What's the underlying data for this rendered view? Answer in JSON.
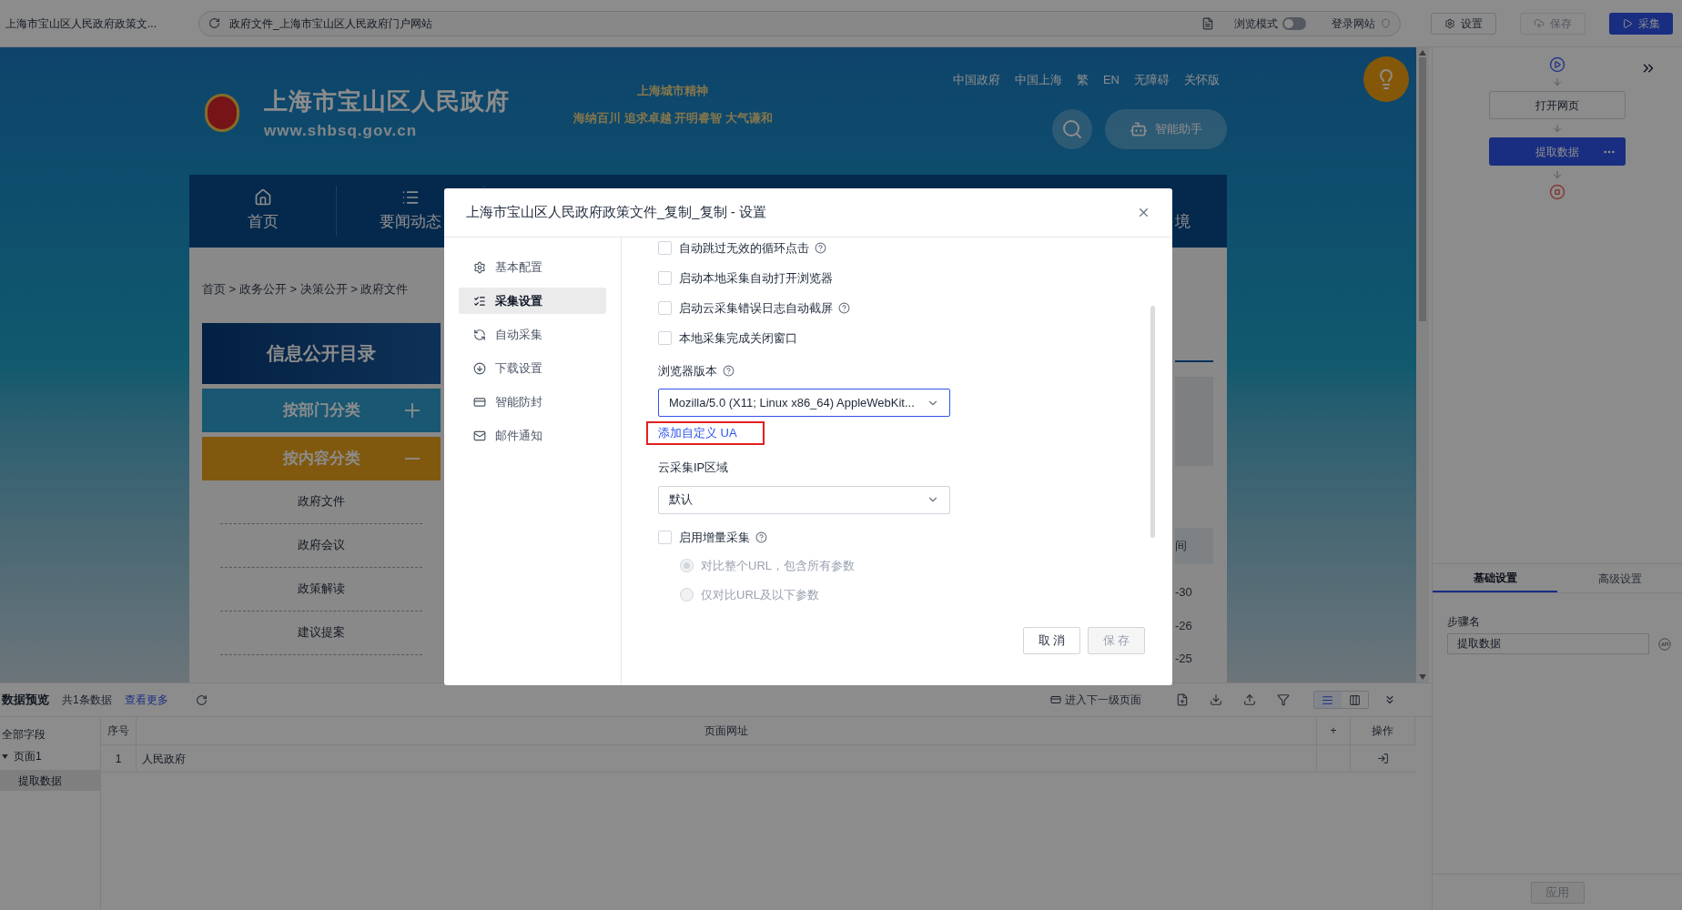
{
  "browser_bar": {
    "tab_title": "上海市宝山区人民政府政策文...",
    "address": "政府文件_上海市宝山区人民政府门户网站",
    "browse_mode": {
      "label": "浏览模式",
      "on": false
    },
    "login": "登录网站",
    "buttons": [
      {
        "label": "设置",
        "kind": "settings",
        "disabled": false
      },
      {
        "label": "保存",
        "kind": "save",
        "disabled": true
      },
      {
        "label": "采集",
        "kind": "run",
        "disabled": false
      }
    ]
  },
  "webpage": {
    "site_title": "上海市宝山区人民政府",
    "site_url": "www.shbsq.gov.cn",
    "slogan_title": "上海城市精神",
    "slogan": "海纳百川 追求卓越 开明睿智 大气谦和",
    "top_links": [
      "中国政府",
      "中国上海",
      "繁",
      "EN",
      "无障碍",
      "关怀版"
    ],
    "assistant": "智能助手",
    "nav": [
      {
        "label": "首页"
      },
      {
        "label": "要闻动态"
      },
      {
        "label": "境"
      }
    ],
    "breadcrumb": "首页 > 政务公开 > 决策公开 > 政府文件",
    "catalog_title": "信息公开目录",
    "categories": [
      {
        "label": "按部门分类",
        "expanded": false
      },
      {
        "label": "按内容分类",
        "expanded": true
      }
    ],
    "category_items": [
      "政府文件",
      "政府会议",
      "政策解读",
      "建议提案"
    ],
    "column_fragment": "间",
    "date_fragments": [
      "-30",
      "-26",
      "-25"
    ]
  },
  "data_preview": {
    "title": "数据预览",
    "count": "共1条数据",
    "more_link": "查看更多",
    "next_level": "进入下一级页面",
    "view_modes": [
      {
        "selected": true
      },
      {
        "selected": false
      }
    ],
    "tree": {
      "root": "全部字段",
      "pages": [
        {
          "label": "页面1",
          "expanded": true,
          "children": [
            {
              "label": "提取数据",
              "selected": true
            }
          ]
        }
      ]
    },
    "table": {
      "columns": [
        "序号",
        "页面网址",
        "+",
        "操作"
      ],
      "rows": [
        {
          "index": "1",
          "value": "人民政府"
        }
      ]
    }
  },
  "workflow": {
    "steps": [
      {
        "label": "打开网页",
        "selected": false
      },
      {
        "label": "提取数据",
        "selected": true
      }
    ],
    "tabs": [
      {
        "label": "基础设置",
        "selected": true
      },
      {
        "label": "高级设置",
        "selected": false
      }
    ],
    "step_name_label": "步骤名",
    "step_name_value": "提取数据",
    "apply": "应用"
  },
  "dialog": {
    "title": "上海市宝山区人民政府政策文件_复制_复制 - 设置",
    "menu": [
      {
        "label": "基本配置",
        "selected": false
      },
      {
        "label": "采集设置",
        "selected": true
      },
      {
        "label": "自动采集",
        "selected": false
      },
      {
        "label": "下载设置",
        "selected": false
      },
      {
        "label": "智能防封",
        "selected": false
      },
      {
        "label": "邮件通知",
        "selected": false
      }
    ],
    "options": [
      {
        "label": "自动跳过无效的循环点击",
        "checked": false,
        "help": true
      },
      {
        "label": "启动本地采集自动打开浏览器",
        "checked": false,
        "help": false
      },
      {
        "label": "启动云采集错误日志自动截屏",
        "checked": false,
        "help": true
      },
      {
        "label": "本地采集完成关闭窗口",
        "checked": false,
        "help": false
      }
    ],
    "browser_version": {
      "label": "浏览器版本",
      "value": "Mozilla/5.0 (X11; Linux x86_64) AppleWebKit...",
      "focused": true
    },
    "custom_ua_link": {
      "label": "添加自定义 UA",
      "highlighted": true
    },
    "ip_region": {
      "label": "云采集IP区域",
      "value": "默认",
      "focused": false
    },
    "incremental": {
      "label": "启用增量采集",
      "checked": false,
      "help": true
    },
    "compare_modes": [
      {
        "label": "对比整个URL，包含所有参数",
        "selected": true,
        "disabled": true
      },
      {
        "label": "仅对比URL及以下参数",
        "selected": false,
        "disabled": true
      }
    ],
    "buttons": [
      {
        "label": "取 消",
        "disabled": false
      },
      {
        "label": "保 存",
        "disabled": true
      }
    ]
  }
}
